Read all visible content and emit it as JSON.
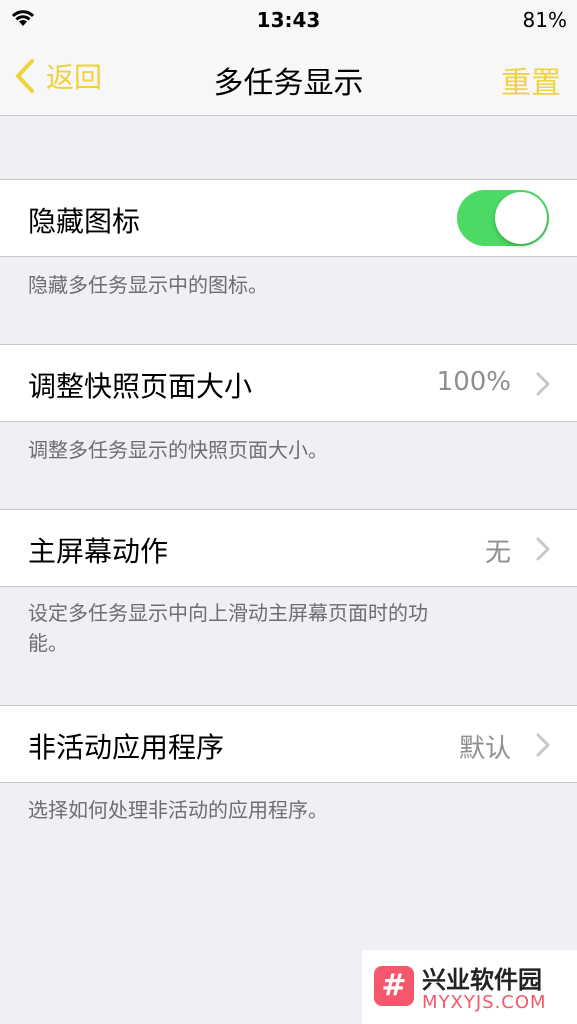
{
  "status": {
    "time": "13:43",
    "battery": "81%",
    "icons": {
      "wifi": "wifi-icon"
    }
  },
  "nav": {
    "back_label": "返回",
    "title": "多任务显示",
    "reset_label": "重置",
    "accent_color": "#f0d33b"
  },
  "settings": [
    {
      "label": "隐藏图标",
      "type": "toggle",
      "on": true,
      "footer": "隐藏多任务显示中的图标。"
    },
    {
      "label": "调整快照页面大小",
      "type": "disclosure",
      "value": "100%",
      "footer": "调整多任务显示的快照页面大小。"
    },
    {
      "label": "主屏幕动作",
      "type": "disclosure",
      "value": "无",
      "footer_line1": "设定多任务显示中向上滑动主屏幕页面时的功",
      "footer_line2": "能。"
    },
    {
      "label": "非活动应用程序",
      "type": "disclosure",
      "value": "默认",
      "footer": "选择如何处理非活动的应用程序。"
    }
  ],
  "toggle_color": "#4cd964",
  "watermark": {
    "name": "兴业软件园",
    "url": "MYXYJS.COM",
    "logo_glyph": "#"
  }
}
